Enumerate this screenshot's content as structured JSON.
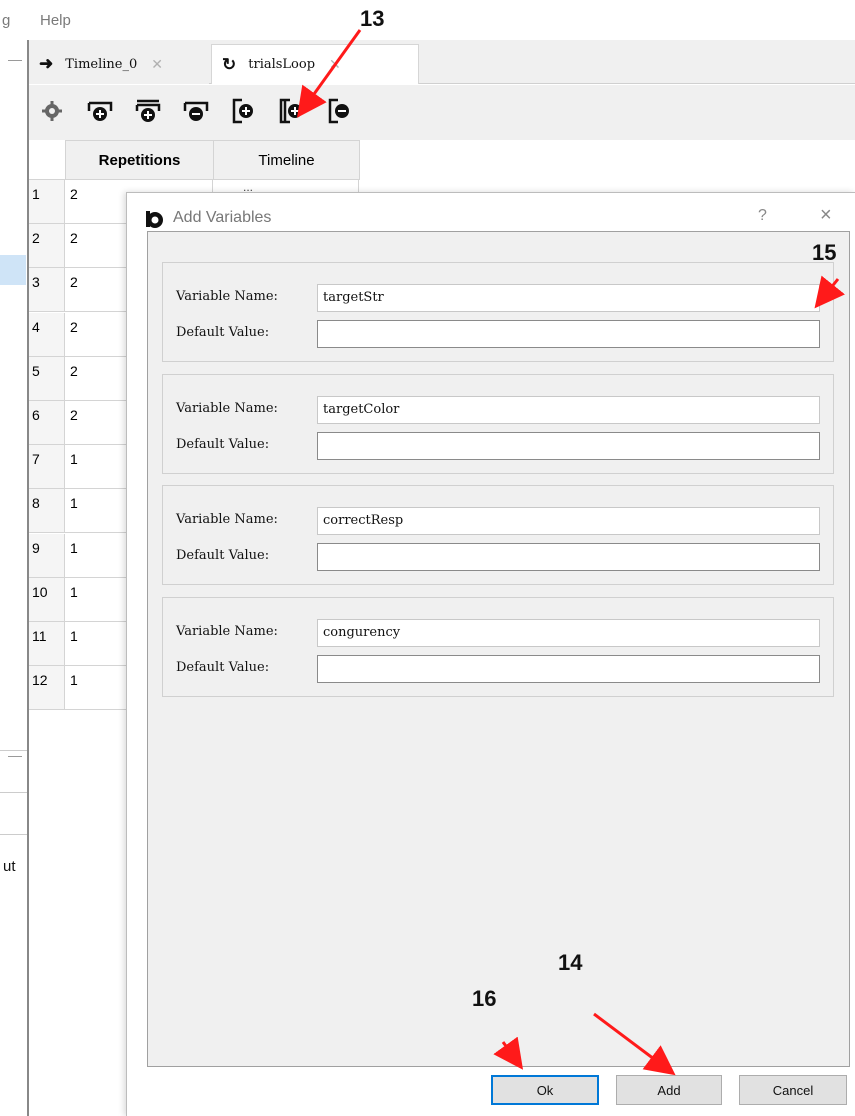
{
  "menubar": {
    "items": [
      "g",
      "Help"
    ]
  },
  "tabs": [
    {
      "label": "Timeline_0",
      "icon": "arrow-right-icon"
    },
    {
      "label": "trialsLoop",
      "icon": "loop-icon"
    }
  ],
  "toolbar": {
    "icons": [
      "gear-icon",
      "add-row-above-icon",
      "add-row-below-icon",
      "remove-row-icon",
      "add-column-left-icon",
      "add-column-right-icon",
      "remove-column-icon"
    ]
  },
  "table": {
    "headers": {
      "repetitions": "Repetitions",
      "timeline": "Timeline"
    },
    "partial_timeline_cell": "...",
    "rows": [
      {
        "num": "1",
        "value": "2"
      },
      {
        "num": "2",
        "value": "2"
      },
      {
        "num": "3",
        "value": "2"
      },
      {
        "num": "4",
        "value": "2"
      },
      {
        "num": "5",
        "value": "2"
      },
      {
        "num": "6",
        "value": "2"
      },
      {
        "num": "7",
        "value": "1"
      },
      {
        "num": "8",
        "value": "1"
      },
      {
        "num": "9",
        "value": "1"
      },
      {
        "num": "10",
        "value": "1"
      },
      {
        "num": "11",
        "value": "1"
      },
      {
        "num": "12",
        "value": "1"
      }
    ]
  },
  "left_panel": {
    "partial_text": "ut"
  },
  "dialog": {
    "title": "Add Variables",
    "help": "?",
    "close": "×",
    "name_label": "Variable Name:",
    "default_label": "Default Value:",
    "variables": [
      {
        "name": "targetStr",
        "default": ""
      },
      {
        "name": "targetColor",
        "default": ""
      },
      {
        "name": "correctResp",
        "default": ""
      },
      {
        "name": "congurency",
        "default": ""
      }
    ],
    "buttons": {
      "ok": "Ok",
      "add": "Add",
      "cancel": "Cancel"
    }
  },
  "annotations": {
    "a13": "13",
    "a14": "14",
    "a15": "15",
    "a16": "16"
  },
  "colors": {
    "annotation_arrow": "#ff1a1a",
    "primary_button_border": "#0078d7",
    "selection": "#cfe4f7"
  }
}
